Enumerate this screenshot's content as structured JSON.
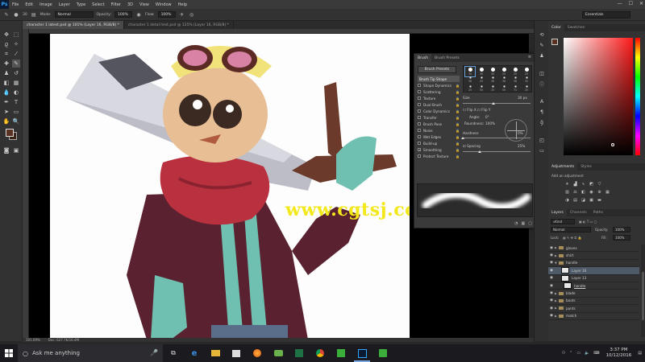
{
  "app": {
    "logo": "Ps"
  },
  "menu": [
    "File",
    "Edit",
    "Image",
    "Layer",
    "Type",
    "Select",
    "Filter",
    "3D",
    "View",
    "Window",
    "Help"
  ],
  "window_controls": {
    "minimize": "—",
    "maximize": "☐",
    "close": "✕"
  },
  "options_bar": {
    "brush_size": "30",
    "mode_label": "Mode:",
    "mode_value": "Normal",
    "opacity_label": "Opacity:",
    "opacity_value": "100%",
    "flow_label": "Flow:",
    "flow_value": "100%",
    "workspace": "Essentials"
  },
  "doc_tabs": [
    {
      "label": "character 1 latest.psd @ 101% (Layer 16, RGB/8) *",
      "active": true
    },
    {
      "label": "character 1 detail test.psd @ 125% (Layer 16, RGB/8) *",
      "active": false
    }
  ],
  "status": {
    "zoom": "101.09%",
    "doc": "Doc: 627.7K/16.4M"
  },
  "watermark": "www.cgtsj.com",
  "brush_panel": {
    "tabs": [
      "Brush",
      "Brush Presets"
    ],
    "presets_button": "Brush Presets",
    "options": [
      {
        "label": "Brush Tip Shape",
        "header": true,
        "checked": false,
        "lock": false
      },
      {
        "label": "Shape Dynamics",
        "checked": false,
        "lock": true
      },
      {
        "label": "Scattering",
        "checked": false,
        "lock": true
      },
      {
        "label": "Texture",
        "checked": false,
        "lock": true
      },
      {
        "label": "Dual Brush",
        "checked": false,
        "lock": true
      },
      {
        "label": "Color Dynamics",
        "checked": false,
        "lock": true
      },
      {
        "label": "Transfer",
        "checked": false,
        "lock": true
      },
      {
        "label": "Brush Pose",
        "checked": false,
        "lock": true
      },
      {
        "label": "Noise",
        "checked": false,
        "lock": true
      },
      {
        "label": "Wet Edges",
        "checked": false,
        "lock": true
      },
      {
        "label": "Build-up",
        "checked": false,
        "lock": true
      },
      {
        "label": "Smoothing",
        "checked": true,
        "lock": true
      },
      {
        "label": "Protect Texture",
        "checked": false,
        "lock": true
      }
    ],
    "tip_sizes": [
      "30",
      "30",
      "30",
      "25",
      "25",
      "25",
      "36",
      "25",
      "36",
      "36",
      "36",
      "32",
      "25",
      "50",
      "25",
      "50",
      "71",
      "25"
    ],
    "size_label": "Size",
    "size_value": "30 px",
    "flip_x": "Flip X",
    "flip_y": "Flip Y",
    "angle_label": "Angle:",
    "angle_value": "0°",
    "roundness_label": "Roundness:",
    "roundness_value": "100%",
    "hardness_label": "Hardness",
    "hardness_value": "0%",
    "spacing_label": "Spacing",
    "spacing_value": "25%",
    "hardness_level": 0,
    "spacing_level": 0.25,
    "size_level": 0.45
  },
  "color_panel": {
    "tabs": [
      "Color",
      "Swatches"
    ],
    "foreground": "#5a3224",
    "background": "#3a2418"
  },
  "adjustments_panel": {
    "tabs": [
      "Adjustments",
      "Styles"
    ],
    "subtitle": "Add an adjustment"
  },
  "layers_panel": {
    "tabs": [
      "Layers",
      "Channels",
      "Paths"
    ],
    "filter_kind": "Kind",
    "blend_mode": "Normal",
    "opacity_label": "Opacity:",
    "opacity_value": "100%",
    "lock_label": "Lock:",
    "fill_label": "Fill:",
    "fill_value": "100%",
    "layers": [
      {
        "name": "gloves",
        "type": "folder",
        "indent": 0,
        "selected": false
      },
      {
        "name": "shirt",
        "type": "folder",
        "indent": 0,
        "selected": false
      },
      {
        "name": "handle",
        "type": "folder",
        "indent": 0,
        "selected": false,
        "open": true
      },
      {
        "name": "Layer 16",
        "type": "layer",
        "indent": 2,
        "selected": true
      },
      {
        "name": "Layer 13",
        "type": "layer",
        "indent": 2,
        "selected": false
      },
      {
        "name": "handle",
        "type": "layer",
        "indent": 1,
        "selected": false
      },
      {
        "name": "blade",
        "type": "folder",
        "indent": 0,
        "selected": false
      },
      {
        "name": "boots",
        "type": "folder",
        "indent": 0,
        "selected": false
      },
      {
        "name": "pants",
        "type": "folder",
        "indent": 0,
        "selected": false
      },
      {
        "name": "match",
        "type": "folder",
        "indent": 0,
        "selected": false
      }
    ]
  },
  "taskbar": {
    "search_placeholder": "Ask me anything",
    "time": "3:37 PM",
    "date": "10/12/2016"
  }
}
